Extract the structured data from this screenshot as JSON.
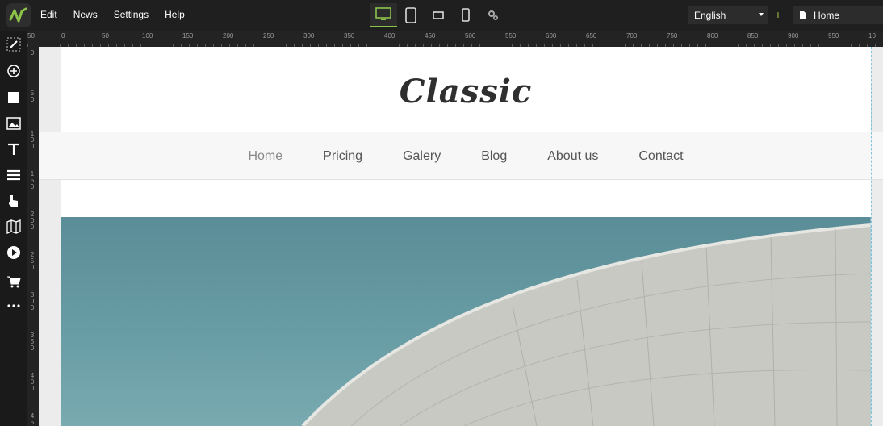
{
  "topbar": {
    "menu": [
      "Edit",
      "News",
      "Settings",
      "Help"
    ],
    "language": "English",
    "page": "Home"
  },
  "ruler": {
    "top_labels": [
      "50",
      "0",
      "50",
      "100",
      "150",
      "200",
      "250",
      "300",
      "350",
      "400",
      "450",
      "500",
      "550",
      "600",
      "650",
      "700",
      "750",
      "800",
      "850",
      "900",
      "950",
      "10"
    ],
    "left_labels": [
      "0",
      "50",
      "100",
      "150",
      "200",
      "250",
      "300",
      "350",
      "400",
      "45"
    ]
  },
  "site": {
    "title": "Classic",
    "nav": [
      "Home",
      "Pricing",
      "Galery",
      "Blog",
      "About us",
      "Contact"
    ]
  },
  "colors": {
    "accent": "#8bc34a",
    "topbar_bg": "#1f1f1f",
    "guide": "#7fc1d8"
  }
}
